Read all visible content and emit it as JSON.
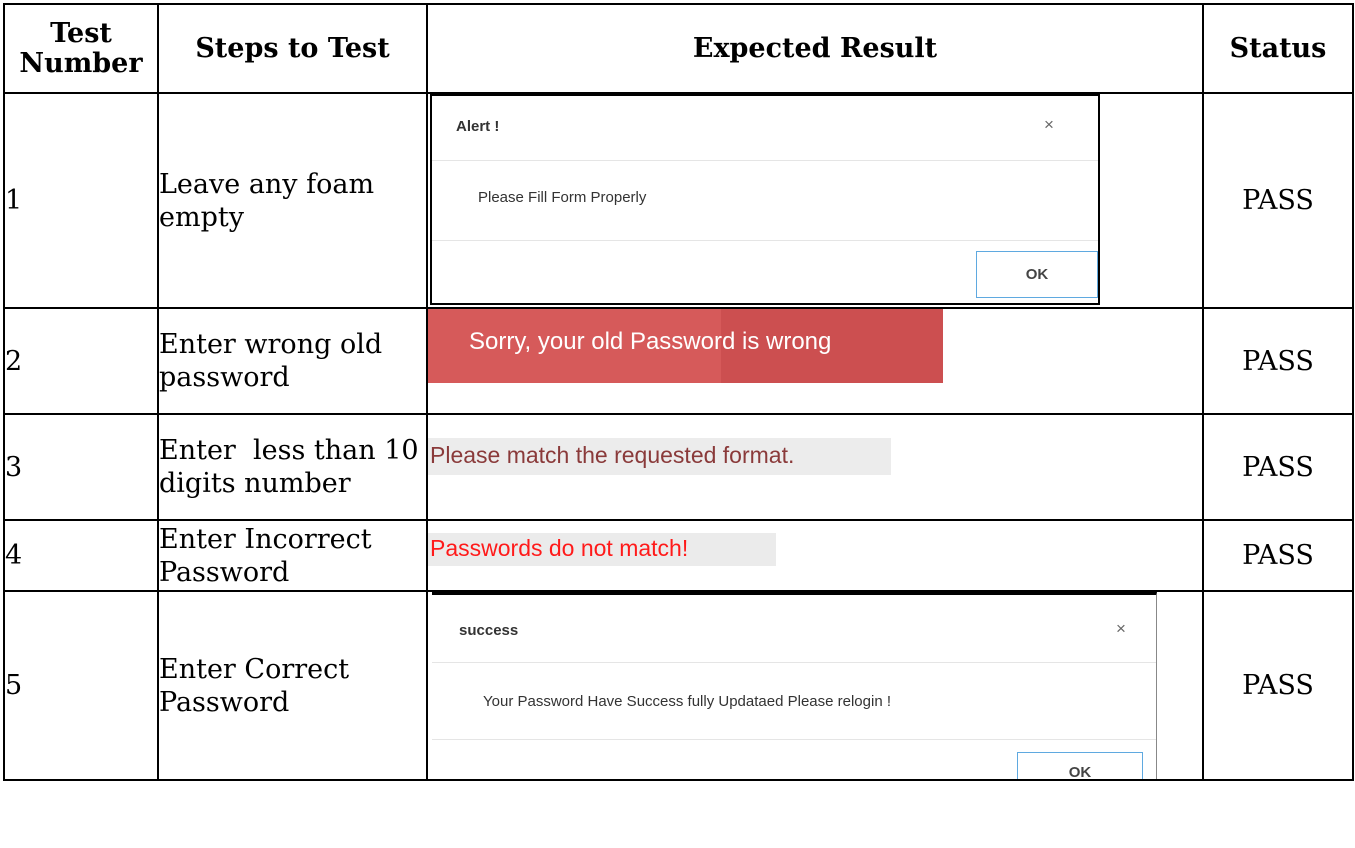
{
  "headers": {
    "test_number": "Test Number",
    "steps": "Steps to Test",
    "expected": "Expected Result",
    "status": "Status"
  },
  "rows": [
    {
      "number": "1",
      "steps": "Leave any foam empty",
      "status": "PASS",
      "expected": {
        "type": "modal",
        "title": "Alert !",
        "close": "×",
        "message": "Please Fill Form Properly",
        "button": "OK"
      }
    },
    {
      "number": "2",
      "steps": "Enter wrong old password",
      "status": "PASS",
      "expected": {
        "type": "banner",
        "message": "Sorry, your old Password is wrong",
        "color": "#d65a5a"
      }
    },
    {
      "number": "3",
      "steps": "Enter  less than 10 digits number",
      "status": "PASS",
      "expected": {
        "type": "tooltip",
        "message": "Please match the requested format.",
        "color": "#8a3a3a"
      }
    },
    {
      "number": "4",
      "steps": "Enter Incorrect Password",
      "status": "PASS",
      "expected": {
        "type": "error-text",
        "message": "Passwords do not match!",
        "color": "#ff1a1a"
      }
    },
    {
      "number": "5",
      "steps": "Enter Correct Password",
      "status": "PASS",
      "expected": {
        "type": "modal",
        "title": "success",
        "close": "×",
        "message": "Your Password Have Success fully Updataed Please relogin !",
        "button": "OK"
      }
    }
  ]
}
